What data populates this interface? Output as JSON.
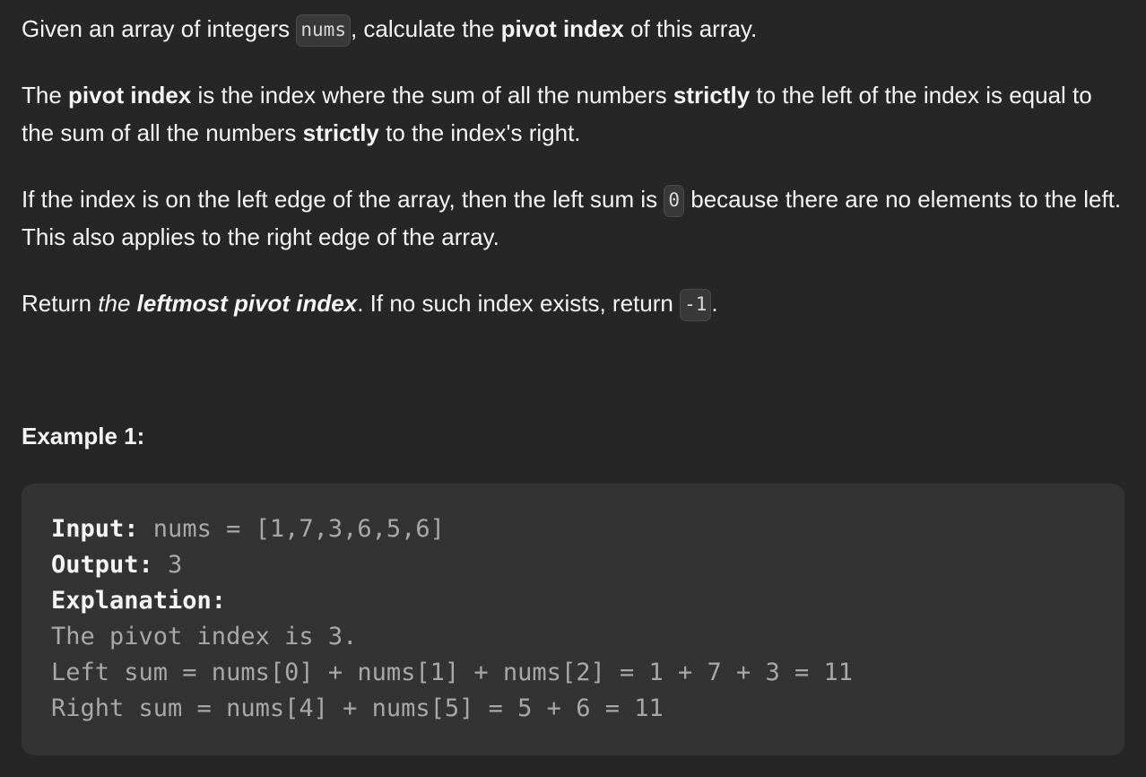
{
  "description": {
    "p1": {
      "t1": "Given an array of integers ",
      "code1": "nums",
      "t2": ", calculate the ",
      "b1": "pivot index",
      "t3": " of this array."
    },
    "p2": {
      "t1": "The ",
      "b1": "pivot index",
      "t2": " is the index where the sum of all the numbers ",
      "b2": "strictly",
      "t3": " to the left of the index is equal to the sum of all the numbers ",
      "b3": "strictly",
      "t4": " to the index's right."
    },
    "p3": {
      "t1": "If the index is on the left edge of the array, then the left sum is ",
      "code1": "0",
      "t2": " because there are no elements to the left. This also applies to the right edge of the array."
    },
    "p4": {
      "t1": "Return ",
      "em1": "the ",
      "em_b1": "leftmost pivot index",
      "t2": ". If no such index exists, return ",
      "code1": "-1",
      "t3": "."
    }
  },
  "example": {
    "title": "Example 1:",
    "input_label": "Input:",
    "input_value": " nums = [1,7,3,6,5,6]",
    "output_label": "Output:",
    "output_value": " 3",
    "explanation_label": "Explanation:",
    "lines": [
      "The pivot index is 3.",
      "Left sum = nums[0] + nums[1] + nums[2] = 1 + 7 + 3 = 11",
      "Right sum = nums[4] + nums[5] = 5 + 6 = 11"
    ]
  }
}
